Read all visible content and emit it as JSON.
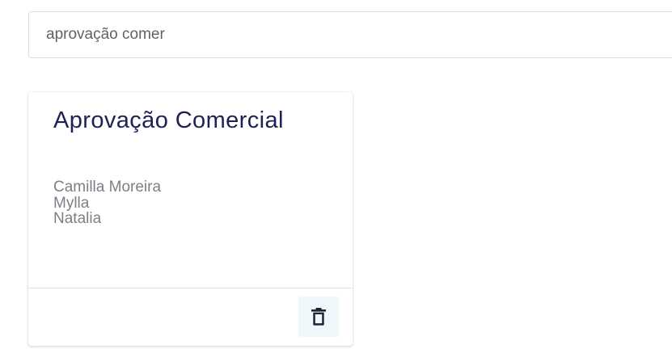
{
  "search": {
    "value": "aprovação comer",
    "icon": "trash-icon"
  },
  "cards": [
    {
      "title": "Aprovação Comercial",
      "members": [
        "Camilla Moreira",
        "Mylla",
        "Natalia"
      ],
      "delete_icon": "trash-icon"
    }
  ],
  "colors": {
    "title": "#1d2256",
    "member_text": "#7c7f85",
    "delete_button_bg": "#eef8fb",
    "icon": "#1d2436"
  }
}
